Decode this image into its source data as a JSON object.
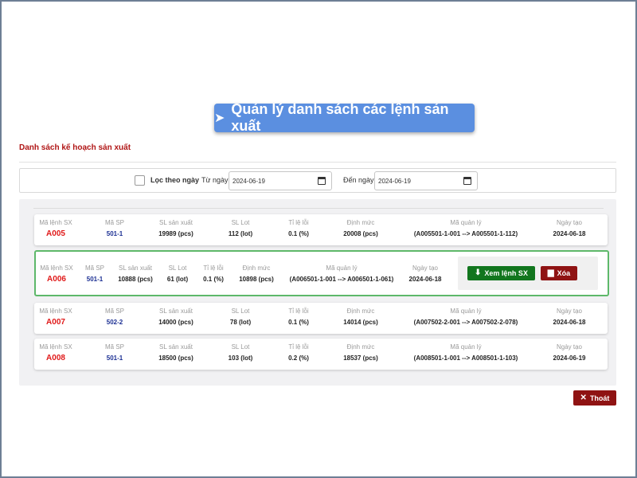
{
  "header": {
    "title": "Quản lý danh sách các lệnh sản xuất",
    "arrow_icon": "chevron-right-icon"
  },
  "section_title": "Danh sách kế hoạch sản xuất",
  "filter": {
    "checkbox_label": "Lọc theo ngày",
    "checked": false,
    "from_label": "Từ ngày",
    "from_value": "2024-06-19",
    "to_label": "Đến ngày",
    "to_value": "2024-06-19"
  },
  "columns": {
    "order_code": "Mã lệnh SX",
    "product_code": "Mã SP",
    "quantity": "SL sản xuất",
    "lot": "SL Lot",
    "defect_rate": "Tỉ lệ lỗi",
    "norm": "Định mức",
    "management_code": "Mã quản lý",
    "created_date": "Ngày tạo"
  },
  "rows": [
    {
      "order_code": "A005",
      "product_code": "501-1",
      "quantity": "19989 (pcs)",
      "lot": "112 (lot)",
      "defect_rate": "0.1 (%)",
      "norm": "20008 (pcs)",
      "management_code": "(A005501-1-001 --> A005501-1-112)",
      "created_date": "2024-06-18"
    },
    {
      "order_code": "A006",
      "product_code": "501-1",
      "quantity": "10888 (pcs)",
      "lot": "61 (lot)",
      "defect_rate": "0.1 (%)",
      "norm": "10898 (pcs)",
      "management_code": "(A006501-1-001 --> A006501-1-061)",
      "created_date": "2024-06-18"
    },
    {
      "order_code": "A007",
      "product_code": "502-2",
      "quantity": "14000 (pcs)",
      "lot": "78 (lot)",
      "defect_rate": "0.1 (%)",
      "norm": "14014 (pcs)",
      "management_code": "(A007502-2-001 --> A007502-2-078)",
      "created_date": "2024-06-18"
    },
    {
      "order_code": "A008",
      "product_code": "501-1",
      "quantity": "18500 (pcs)",
      "lot": "103 (lot)",
      "defect_rate": "0.2 (%)",
      "norm": "18537 (pcs)",
      "management_code": "(A008501-1-001 --> A008501-1-103)",
      "created_date": "2024-06-19"
    }
  ],
  "actions": {
    "view_label": "Xem lệnh SX",
    "view_icon": "download-icon",
    "delete_label": "Xóa",
    "delete_icon": "trash-icon"
  },
  "exit": {
    "label": "Thoát",
    "icon": "close-icon"
  },
  "colors": {
    "header_bg": "#5b8fe0",
    "section_title": "#b01515",
    "order_code": "#e01818",
    "product_code": "#1b2f93",
    "view_button": "#12761e",
    "delete_button": "#8f1313",
    "selected_border": "#5eb86a"
  }
}
